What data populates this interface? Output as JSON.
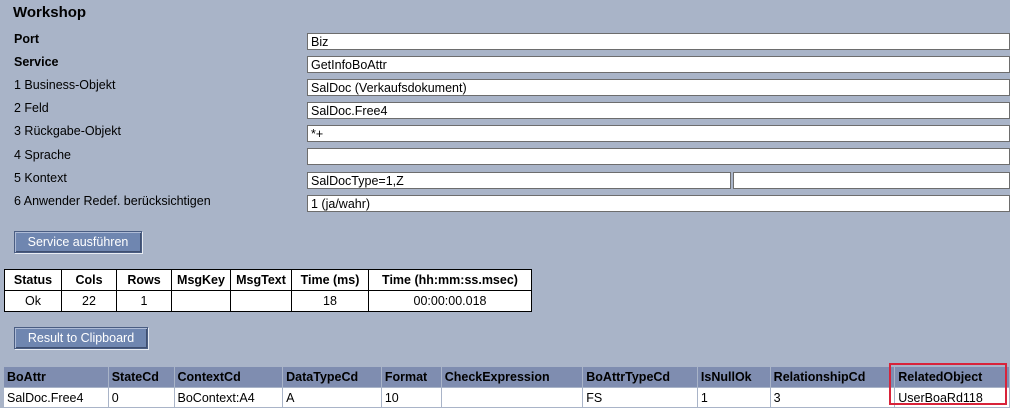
{
  "title": "Workshop",
  "params": [
    {
      "label": "Port",
      "value": "Biz"
    },
    {
      "label": "Service",
      "value": "GetInfoBoAttr"
    },
    {
      "label": "1 Business-Objekt",
      "value": "SalDoc (Verkaufsdokument)"
    },
    {
      "label": "2 Feld",
      "value": "SalDoc.Free4"
    },
    {
      "label": "3 Rückgabe-Objekt",
      "value": "*+"
    },
    {
      "label": "4 Sprache",
      "value": ""
    },
    {
      "label": "5 Kontext",
      "value": "SalDocType=1,Z",
      "value2": ""
    },
    {
      "label": "6 Anwender Redef. berücksichtigen",
      "value": "1 (ja/wahr)"
    }
  ],
  "buttons": {
    "run": "Service ausführen",
    "clipboard": "Result to Clipboard"
  },
  "status_table": {
    "headers": [
      "Status",
      "Cols",
      "Rows",
      "MsgKey",
      "MsgText",
      "Time (ms)",
      "Time (hh:mm:ss.msec)"
    ],
    "row": [
      "Ok",
      "22",
      "1",
      "",
      "",
      "18",
      "00:00:00.018"
    ]
  },
  "result_table": {
    "headers": [
      "BoAttr",
      "StateCd",
      "ContextCd",
      "DataTypeCd",
      "Format",
      "CheckExpression",
      "BoAttrTypeCd",
      "IsNullOk",
      "RelationshipCd",
      "RelatedObject"
    ],
    "row": [
      "SalDoc.Free4",
      "0",
      "BoContext:A4",
      "A",
      "10",
      "",
      "FS",
      "1",
      "3",
      "UserBoaRd118"
    ]
  },
  "colors": {
    "background": "#a9b4c8",
    "button": "#6f86b0",
    "table_header": "#7f8db0",
    "highlight": "#d8233a"
  }
}
